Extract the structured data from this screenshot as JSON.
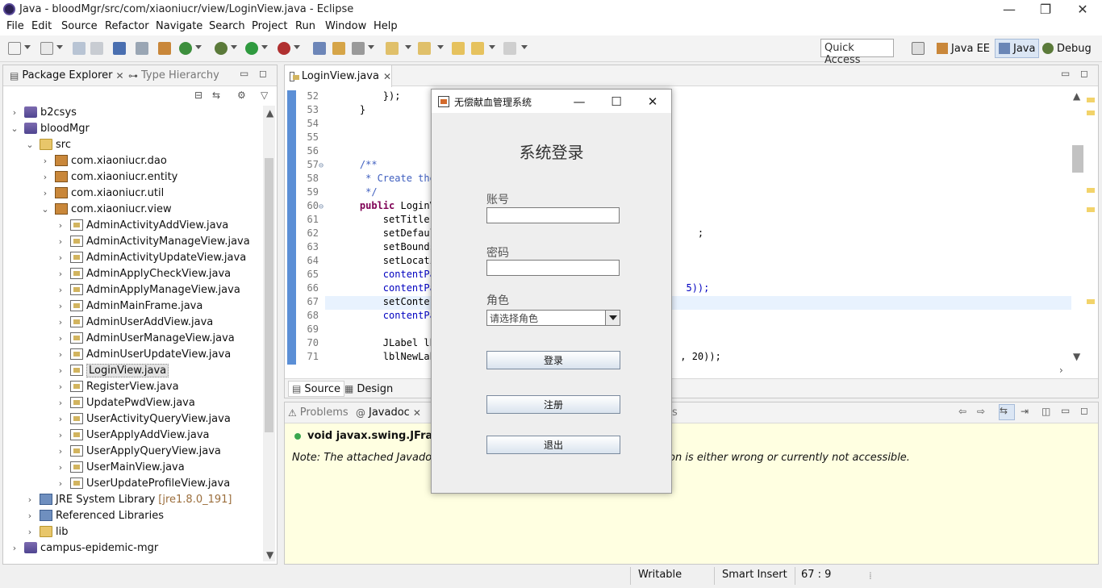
{
  "window": {
    "title": "Java - bloodMgr/src/com/xiaoniucr/view/LoginView.java - Eclipse",
    "minimize": "—",
    "restore": "❐",
    "close": "✕"
  },
  "menu": [
    "File",
    "Edit",
    "Source",
    "Refactor",
    "Navigate",
    "Search",
    "Project",
    "Run",
    "Window",
    "Help"
  ],
  "toolbar": {
    "quick_access": "Quick Access",
    "perspectives": [
      {
        "label": "Java EE",
        "active": false
      },
      {
        "label": "Java",
        "active": true
      },
      {
        "label": "Debug",
        "active": false
      }
    ]
  },
  "package_explorer": {
    "tabs": [
      {
        "label": "Package Explorer",
        "close": "✕",
        "active": true
      },
      {
        "label": "Type Hierarchy",
        "active": false
      }
    ],
    "tree": [
      {
        "label": "b2csys",
        "kind": "proj",
        "depth": 0,
        "twisty": "›"
      },
      {
        "label": "bloodMgr",
        "kind": "proj",
        "depth": 0,
        "twisty": "⌄"
      },
      {
        "label": "src",
        "kind": "folder",
        "depth": 1,
        "twisty": "⌄"
      },
      {
        "label": "com.xiaoniucr.dao",
        "kind": "pkg",
        "depth": 2,
        "twisty": "›"
      },
      {
        "label": "com.xiaoniucr.entity",
        "kind": "pkg",
        "depth": 2,
        "twisty": "›"
      },
      {
        "label": "com.xiaoniucr.util",
        "kind": "pkg",
        "depth": 2,
        "twisty": "›"
      },
      {
        "label": "com.xiaoniucr.view",
        "kind": "pkg",
        "depth": 2,
        "twisty": "⌄"
      },
      {
        "label": "AdminActivityAddView.java",
        "kind": "java",
        "depth": 3,
        "twisty": "›"
      },
      {
        "label": "AdminActivityManageView.java",
        "kind": "java",
        "depth": 3,
        "twisty": "›"
      },
      {
        "label": "AdminActivityUpdateView.java",
        "kind": "java",
        "depth": 3,
        "twisty": "›"
      },
      {
        "label": "AdminApplyCheckView.java",
        "kind": "java",
        "depth": 3,
        "twisty": "›"
      },
      {
        "label": "AdminApplyManageView.java",
        "kind": "java",
        "depth": 3,
        "twisty": "›"
      },
      {
        "label": "AdminMainFrame.java",
        "kind": "java",
        "depth": 3,
        "twisty": "›"
      },
      {
        "label": "AdminUserAddView.java",
        "kind": "java",
        "depth": 3,
        "twisty": "›"
      },
      {
        "label": "AdminUserManageView.java",
        "kind": "java",
        "depth": 3,
        "twisty": "›"
      },
      {
        "label": "AdminUserUpdateView.java",
        "kind": "java",
        "depth": 3,
        "twisty": "›"
      },
      {
        "label": "LoginView.java",
        "kind": "java",
        "depth": 3,
        "twisty": "›",
        "selected": true
      },
      {
        "label": "RegisterView.java",
        "kind": "java",
        "depth": 3,
        "twisty": "›"
      },
      {
        "label": "UpdatePwdView.java",
        "kind": "java",
        "depth": 3,
        "twisty": "›"
      },
      {
        "label": "UserActivityQueryView.java",
        "kind": "java",
        "depth": 3,
        "twisty": "›"
      },
      {
        "label": "UserApplyAddView.java",
        "kind": "java",
        "depth": 3,
        "twisty": "›"
      },
      {
        "label": "UserApplyQueryView.java",
        "kind": "java",
        "depth": 3,
        "twisty": "›"
      },
      {
        "label": "UserMainView.java",
        "kind": "java",
        "depth": 3,
        "twisty": "›"
      },
      {
        "label": "UserUpdateProfileView.java",
        "kind": "java",
        "depth": 3,
        "twisty": "›"
      },
      {
        "label": "JRE System Library",
        "suffix": "[jre1.8.0_191]",
        "kind": "lib",
        "depth": 1,
        "twisty": "›"
      },
      {
        "label": "Referenced Libraries",
        "kind": "lib",
        "depth": 1,
        "twisty": "›"
      },
      {
        "label": "lib",
        "kind": "folder",
        "depth": 1,
        "twisty": "›"
      },
      {
        "label": "campus-epidemic-mgr",
        "kind": "proj",
        "depth": 0,
        "twisty": "›"
      }
    ]
  },
  "editor": {
    "tab_label": "LoginView.java",
    "tab_close": "✕",
    "lines": [
      {
        "n": "52",
        "fold": "",
        "text": "        });",
        "cls": "code"
      },
      {
        "n": "53",
        "fold": "",
        "text": "    }",
        "cls": "code"
      },
      {
        "n": "54",
        "fold": "",
        "text": "",
        "cls": "code"
      },
      {
        "n": "55",
        "fold": "",
        "text": "",
        "cls": "code"
      },
      {
        "n": "56",
        "fold": "",
        "text": "",
        "cls": "code"
      },
      {
        "n": "57",
        "fold": "⊖",
        "text": "    /**",
        "cls": "cm"
      },
      {
        "n": "58",
        "fold": "",
        "text": "     * Create the",
        "cls": "cm"
      },
      {
        "n": "59",
        "fold": "",
        "text": "     */",
        "cls": "cm"
      },
      {
        "n": "60",
        "fold": "⊖",
        "text": "    public LoginV",
        "cls": "kwline"
      },
      {
        "n": "61",
        "fold": "",
        "text": "        setTitle",
        "cls": "code"
      },
      {
        "n": "62",
        "fold": "",
        "text": "        setDefaul                                             ;",
        "cls": "code"
      },
      {
        "n": "63",
        "fold": "",
        "text": "        setBounds",
        "cls": "code"
      },
      {
        "n": "64",
        "fold": "",
        "text": "        setLocati",
        "cls": "code"
      },
      {
        "n": "65",
        "fold": "",
        "text": "        contentPa",
        "cls": "fld"
      },
      {
        "n": "66",
        "fold": "",
        "text": "        contentPa                                           5));",
        "cls": "fldtail"
      },
      {
        "n": "67",
        "fold": "",
        "text": "        setConter",
        "cls": "code"
      },
      {
        "n": "68",
        "fold": "",
        "text": "        contentPa",
        "cls": "fld"
      },
      {
        "n": "69",
        "fold": "",
        "text": "",
        "cls": "code"
      },
      {
        "n": "70",
        "fold": "",
        "text": "        JLabel lb",
        "cls": "code"
      },
      {
        "n": "71",
        "fold": "",
        "text": "        lblNewLab                                          , 20));",
        "cls": "code"
      }
    ],
    "subtabs": [
      {
        "label": "Source",
        "active": true
      },
      {
        "label": "Design",
        "active": false
      }
    ]
  },
  "javadoc": {
    "tabs": [
      {
        "label": "Problems",
        "active": false
      },
      {
        "label": "Javadoc",
        "close": "✕",
        "active": true
      },
      {
        "label": "s",
        "active": false
      }
    ],
    "method_left": "void javax.swing.JFrame.s",
    "note_left": "Note: The attached Javadoc co",
    "note_right": "on is either wrong or currently not accessible."
  },
  "statusbar": {
    "writable": "Writable",
    "insert_mode": "Smart Insert",
    "position": "67 : 9"
  },
  "login_dialog": {
    "title": "无偿献血管理系统",
    "minimize": "—",
    "maximize": "☐",
    "close": "✕",
    "heading": "系统登录",
    "account_label": "账号",
    "account_value": "",
    "password_label": "密码",
    "password_value": "",
    "role_label": "角色",
    "role_placeholder": "请选择角色",
    "login_button": "登录",
    "register_button": "注册",
    "exit_button": "退出"
  }
}
